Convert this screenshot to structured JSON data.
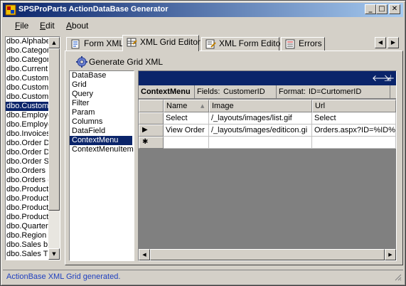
{
  "window": {
    "title": "SPSProParts ActionDataBase Generator",
    "minimize_glyph": "_",
    "maximize_glyph": "□",
    "close_glyph": "✕"
  },
  "menu": {
    "file_accel": "F",
    "file_rest": "ile",
    "edit_accel": "E",
    "edit_rest": "dit",
    "about_accel": "A",
    "about_rest": "bout"
  },
  "left_list": {
    "items": [
      "dbo.Alphabe",
      "dbo.Categor",
      "dbo.Categor",
      "dbo.Current",
      "dbo.Custome",
      "dbo.Custome",
      "dbo.Custome",
      "dbo.Custome",
      "dbo.Employe",
      "dbo.Employe",
      "dbo.Invoices",
      "dbo.Order D",
      "dbo.Order D",
      "dbo.Order S",
      "dbo.Orders",
      "dbo.Orders (",
      "dbo.Product",
      "dbo.Product",
      "dbo.Product",
      "dbo.Product",
      "dbo.Quarterl",
      "dbo.Region",
      "dbo.Sales b",
      "dbo.Sales T"
    ],
    "selected_index": 7
  },
  "tabs": [
    {
      "label": "Form XML",
      "icon": "form-xml-icon"
    },
    {
      "label": "XML Grid Editor",
      "icon": "grid-editor-icon"
    },
    {
      "label": "XML Form Editor",
      "icon": "form-editor-icon"
    },
    {
      "label": "Errors",
      "icon": "errors-icon"
    }
  ],
  "active_tab": 1,
  "generate_button": {
    "label": "Generate Grid XML",
    "icon": "gear-icon"
  },
  "node_list": {
    "items": [
      "DataBase",
      "Grid",
      "Query",
      "Filter",
      "Param",
      "Columns",
      "DataField",
      "ContextMenu",
      "ContextMenuItem"
    ],
    "selected_index": 7
  },
  "grid": {
    "caption_icons": [
      "back-arrow-icon",
      "toggle-details-icon"
    ],
    "caption_back": "🡐",
    "caption_toggle": "⇲",
    "parent_row": {
      "table": "ContextMenu",
      "fields_label": "Fields:",
      "fields_value": "CustomerID",
      "format_label": "Format:",
      "format_value": "ID=CurtomerID"
    },
    "columns": [
      "Name",
      "Image",
      "Url"
    ],
    "sort_indicator": "▲",
    "rows": [
      {
        "marker": "",
        "name": "Select",
        "image": "/_layouts/images/list.gif",
        "url": "Select"
      },
      {
        "marker": "▶",
        "name": "View Order",
        "image": "/_layouts/images/editicon.gi",
        "url": "Orders.aspx?ID=%ID%"
      },
      {
        "marker": "✱",
        "name": "",
        "image": "",
        "url": ""
      }
    ]
  },
  "status": {
    "text": "ActionBase XML Grid generated."
  },
  "colors": {
    "title_bar_start": "#0a246a",
    "title_bar_end": "#a6caf0",
    "selection": "#0a246a",
    "status_text": "#1f3fbf",
    "grid_background": "#808080",
    "window_face": "#d4d0c8"
  }
}
